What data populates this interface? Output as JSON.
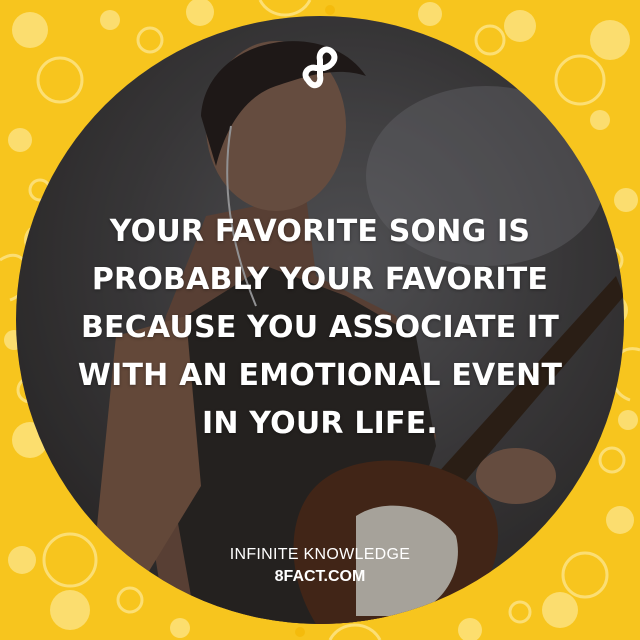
{
  "fact": {
    "lines": [
      "YOUR FAVORITE SONG IS",
      "PROBABLY YOUR FAVORITE",
      "BECAUSE YOU ASSOCIATE IT",
      "WITH AN EMOTIONAL EVENT",
      "IN YOUR LIFE."
    ]
  },
  "brand": {
    "tagline": "INFINITE KNOWLEDGE",
    "site": "8FACT.COM",
    "logo_icon": "infinity-8-logo-icon"
  },
  "colors": {
    "background": "#f7c51e",
    "pattern": "#fde58a",
    "text": "#ffffff"
  },
  "photo": {
    "subject": "guitarist-performing"
  }
}
